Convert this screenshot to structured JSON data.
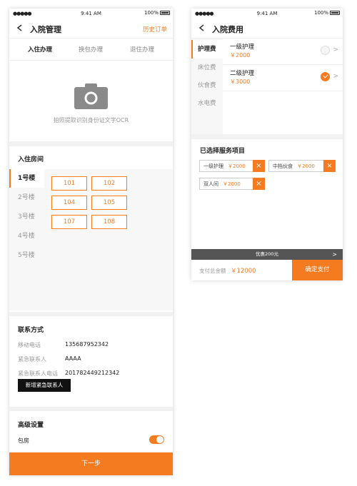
{
  "status_bar": {
    "signal": "●●●●●",
    "time": "9:41 AM",
    "battery": "100%"
  },
  "screen1": {
    "nav": {
      "title": "入院管理",
      "link": "历史订单"
    },
    "tabs": [
      "入住办理",
      "换包办理",
      "退住办理"
    ],
    "ocr": {
      "hint": "拍照提取识别身份证文字OCR",
      "icon": "camera-icon"
    },
    "room": {
      "title": "入住房间",
      "buildings": [
        "1号楼",
        "2号楼",
        "3号楼",
        "4号楼",
        "5号楼"
      ],
      "rooms": [
        "101",
        "102",
        "104",
        "105",
        "107",
        "108"
      ]
    },
    "contact": {
      "title": "联系方式",
      "rows": [
        {
          "label": "移动电话",
          "value": "135687952342"
        },
        {
          "label": "紧急联系人",
          "value": "AAAA"
        },
        {
          "label": "紧急联系人电话",
          "value": "201782449212342"
        }
      ],
      "add_button": "新增紧急联系人"
    },
    "advanced": {
      "title": "高级设置",
      "toggle_label": "包房",
      "toggle_on": true
    },
    "next_button": "下一步"
  },
  "screen2": {
    "nav": {
      "title": "入院费用"
    },
    "categories": [
      "护理费",
      "床位费",
      "伙食费",
      "水电费"
    ],
    "fees": [
      {
        "name": "一级护理",
        "price": "￥2000",
        "selected": false
      },
      {
        "name": "二级护理",
        "price": "￥3000",
        "selected": true
      }
    ],
    "selected_section": {
      "title": "已选择服务项目",
      "chips": [
        {
          "name": "一级护理",
          "price": "￥2000"
        },
        {
          "name": "中档伙食",
          "price": "￥2000"
        },
        {
          "name": "双人间",
          "price": "￥2000"
        }
      ]
    },
    "promo": "优惠200元",
    "pay": {
      "label": "支付总金额",
      "amount": "￥12000",
      "button": "确定支付"
    }
  },
  "colors": {
    "accent": "#f47b20",
    "dark_button": "#111111",
    "promo_bar": "#555555"
  }
}
